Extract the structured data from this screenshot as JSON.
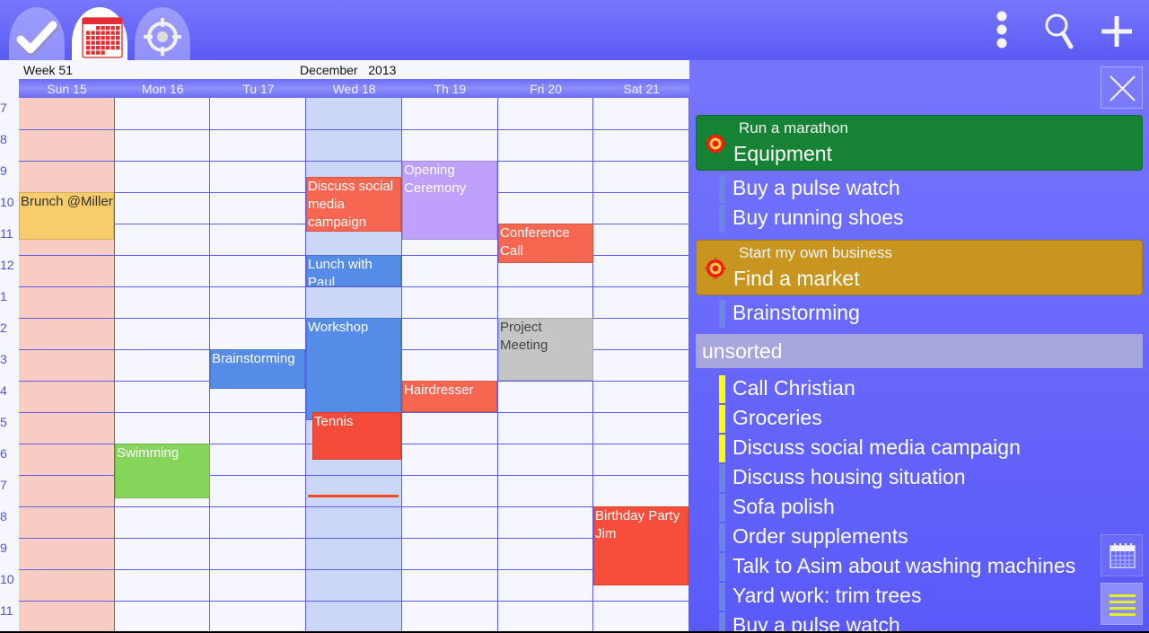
{
  "app": {
    "tabs": [
      {
        "name": "tasks",
        "icon": "checkmark-icon",
        "active": false
      },
      {
        "name": "calendar",
        "icon": "calendar-icon",
        "active": true
      },
      {
        "name": "goals",
        "icon": "target-icon",
        "active": false
      }
    ],
    "actions": [
      {
        "name": "overflow-menu",
        "icon": "more-vert-icon"
      },
      {
        "name": "search",
        "icon": "search-icon"
      },
      {
        "name": "add",
        "icon": "plus-icon"
      }
    ]
  },
  "calendar": {
    "week_label": "Week 51",
    "month_label": "December   2013",
    "days": [
      "Sun 15",
      "Mon 16",
      "Tu 17",
      "Wed 18",
      "Th 19",
      "Fri 20",
      "Sat 21"
    ],
    "weekend_day_index": 0,
    "today_index": 3,
    "hours": [
      "7",
      "8",
      "9",
      "10",
      "11",
      "12",
      "1",
      "2",
      "3",
      "4",
      "5",
      "6",
      "7",
      "8",
      "9",
      "10",
      "11"
    ],
    "first_hour": 7,
    "now_time": 19.75,
    "events": [
      {
        "title": "Brunch @Miller",
        "day": 0,
        "start": 10.0,
        "end": 11.5,
        "color": "#f7cc6b",
        "text_color": "#333333"
      },
      {
        "title": "Discuss social media campaign",
        "day": 3,
        "start": 9.5,
        "end": 11.25,
        "color": "#f66651",
        "text_color": "#ffffff"
      },
      {
        "title": "Opening Ceremony",
        "day": 4,
        "start": 9.0,
        "end": 11.5,
        "color": "#bfa1fc",
        "text_color": "#ffffff"
      },
      {
        "title": "Conference Call",
        "day": 5,
        "start": 11.0,
        "end": 12.25,
        "color": "#f66651",
        "text_color": "#ffffff"
      },
      {
        "title": "Lunch with Paul",
        "day": 3,
        "start": 12.0,
        "end": 13.0,
        "color": "#558ce8",
        "text_color": "#ffffff"
      },
      {
        "title": "Workshop",
        "day": 3,
        "start": 14.0,
        "end": 17.25,
        "color": "#558ce8",
        "text_color": "#ffffff"
      },
      {
        "title": "Project Meeting",
        "day": 5,
        "start": 14.0,
        "end": 16.0,
        "color": "#c5c5c5",
        "text_color": "#444444"
      },
      {
        "title": "Brainstorming",
        "day": 2,
        "start": 15.0,
        "end": 16.25,
        "color": "#558ce8",
        "text_color": "#ffffff"
      },
      {
        "title": "Hairdresser",
        "day": 4,
        "start": 16.0,
        "end": 17.0,
        "color": "#f66651",
        "text_color": "#ffffff"
      },
      {
        "title": "Tennis",
        "day": 3,
        "start": 17.0,
        "end": 18.5,
        "color": "#f34a3a",
        "text_color": "#ffffff",
        "indent": true
      },
      {
        "title": "Swimming",
        "day": 1,
        "start": 18.0,
        "end": 19.75,
        "color": "#86d55b",
        "text_color": "#ffffff"
      },
      {
        "title": "Birthday Party Jim",
        "day": 6,
        "start": 20.0,
        "end": 22.5,
        "color": "#f74e3c",
        "text_color": "#ffffff"
      }
    ]
  },
  "tasks_panel": {
    "close_icon": "close-icon",
    "goals": [
      {
        "goal": "Run a marathon",
        "title": "Equipment",
        "color": "#158234",
        "items": [
          "Buy a pulse watch",
          "Buy running shoes"
        ]
      },
      {
        "goal": "Start my own business",
        "title": "Find a market",
        "color": "#c8961f",
        "items": [
          "Brainstorming"
        ]
      }
    ],
    "unsorted_label": "unsorted",
    "unsorted": [
      {
        "label": "Call Christian",
        "priority": "high"
      },
      {
        "label": "Groceries",
        "priority": "high"
      },
      {
        "label": "Discuss social media campaign",
        "priority": "high"
      },
      {
        "label": "Discuss housing situation",
        "priority": "normal"
      },
      {
        "label": "Sofa polish",
        "priority": "normal"
      },
      {
        "label": "Order supplements",
        "priority": "normal"
      },
      {
        "label": "Talk to Asim about washing machines",
        "priority": "normal"
      },
      {
        "label": "Yard work: trim trees",
        "priority": "normal"
      },
      {
        "label": "Buy a pulse watch",
        "priority": "normal"
      }
    ],
    "side_buttons": [
      {
        "name": "calendar-view",
        "icon": "calendar-icon"
      },
      {
        "name": "list-view",
        "icon": "list-icon"
      }
    ]
  }
}
